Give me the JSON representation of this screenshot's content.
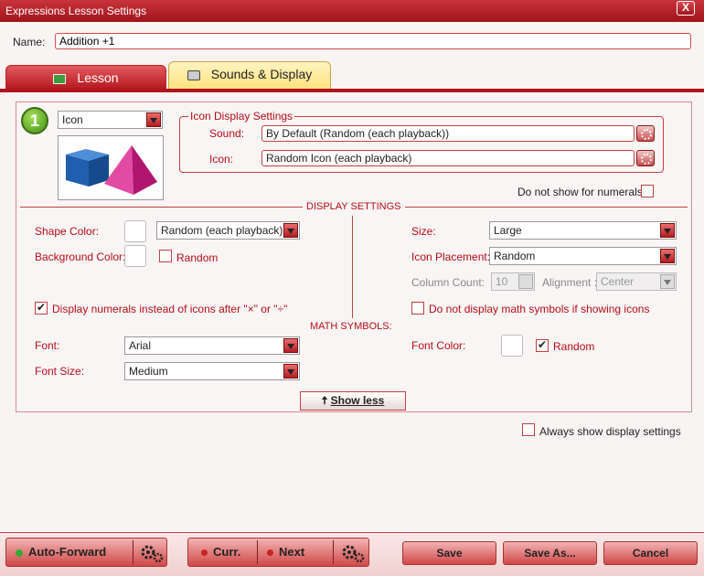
{
  "window": {
    "title": "Expressions Lesson Settings",
    "close_glyph": "X"
  },
  "name": {
    "label": "Name:",
    "value": "Addition +1"
  },
  "tabs": [
    {
      "label": "Lesson",
      "active": false
    },
    {
      "label": "Sounds & Display",
      "active": true
    }
  ],
  "step": {
    "number": "1",
    "type_select": "Icon"
  },
  "icon_display": {
    "legend": "Icon Display Settings",
    "sound_label": "Sound:",
    "sound_value": "By Default (Random (each playback))",
    "icon_label": "Icon:",
    "icon_value": "Random Icon (each playback)"
  },
  "numerals": {
    "label": "Do not show for numerals:",
    "checked": false
  },
  "display_settings": {
    "title": "DISPLAY SETTINGS",
    "shape_color_label": "Shape Color:",
    "shape_color_select": "Random (each playback)",
    "background_color_label": "Background Color:",
    "background_random_label": "Random",
    "size_label": "Size:",
    "size_value": "Large",
    "icon_placement_label": "Icon Placement:",
    "icon_placement_value": "Random",
    "column_count_label": "Column Count:",
    "column_count_value": "10",
    "alignment_label": "Alignment :",
    "alignment_value": "Center",
    "display_numerals_label": "Display numerals instead of icons after \"×\" or \"÷\"",
    "no_math_symbols_label": "Do not display math symbols if showing icons"
  },
  "math_symbols": {
    "title": "MATH SYMBOLS:",
    "font_label": "Font:",
    "font_value": "Arial",
    "font_size_label": "Font Size:",
    "font_size_value": "Medium",
    "font_color_label": "Font Color:",
    "font_color_random_label": "Random"
  },
  "show_less": {
    "label": "Show less",
    "arrow": "🠅"
  },
  "always_show": {
    "label": "Always show display settings"
  },
  "bottom": {
    "auto_forward": "Auto-Forward",
    "curr": "Curr.",
    "next": "Next",
    "save": "Save",
    "save_as": "Save As...",
    "cancel": "Cancel"
  },
  "colors": {
    "accent": "#b0141c",
    "label_red": "#b30d18"
  }
}
